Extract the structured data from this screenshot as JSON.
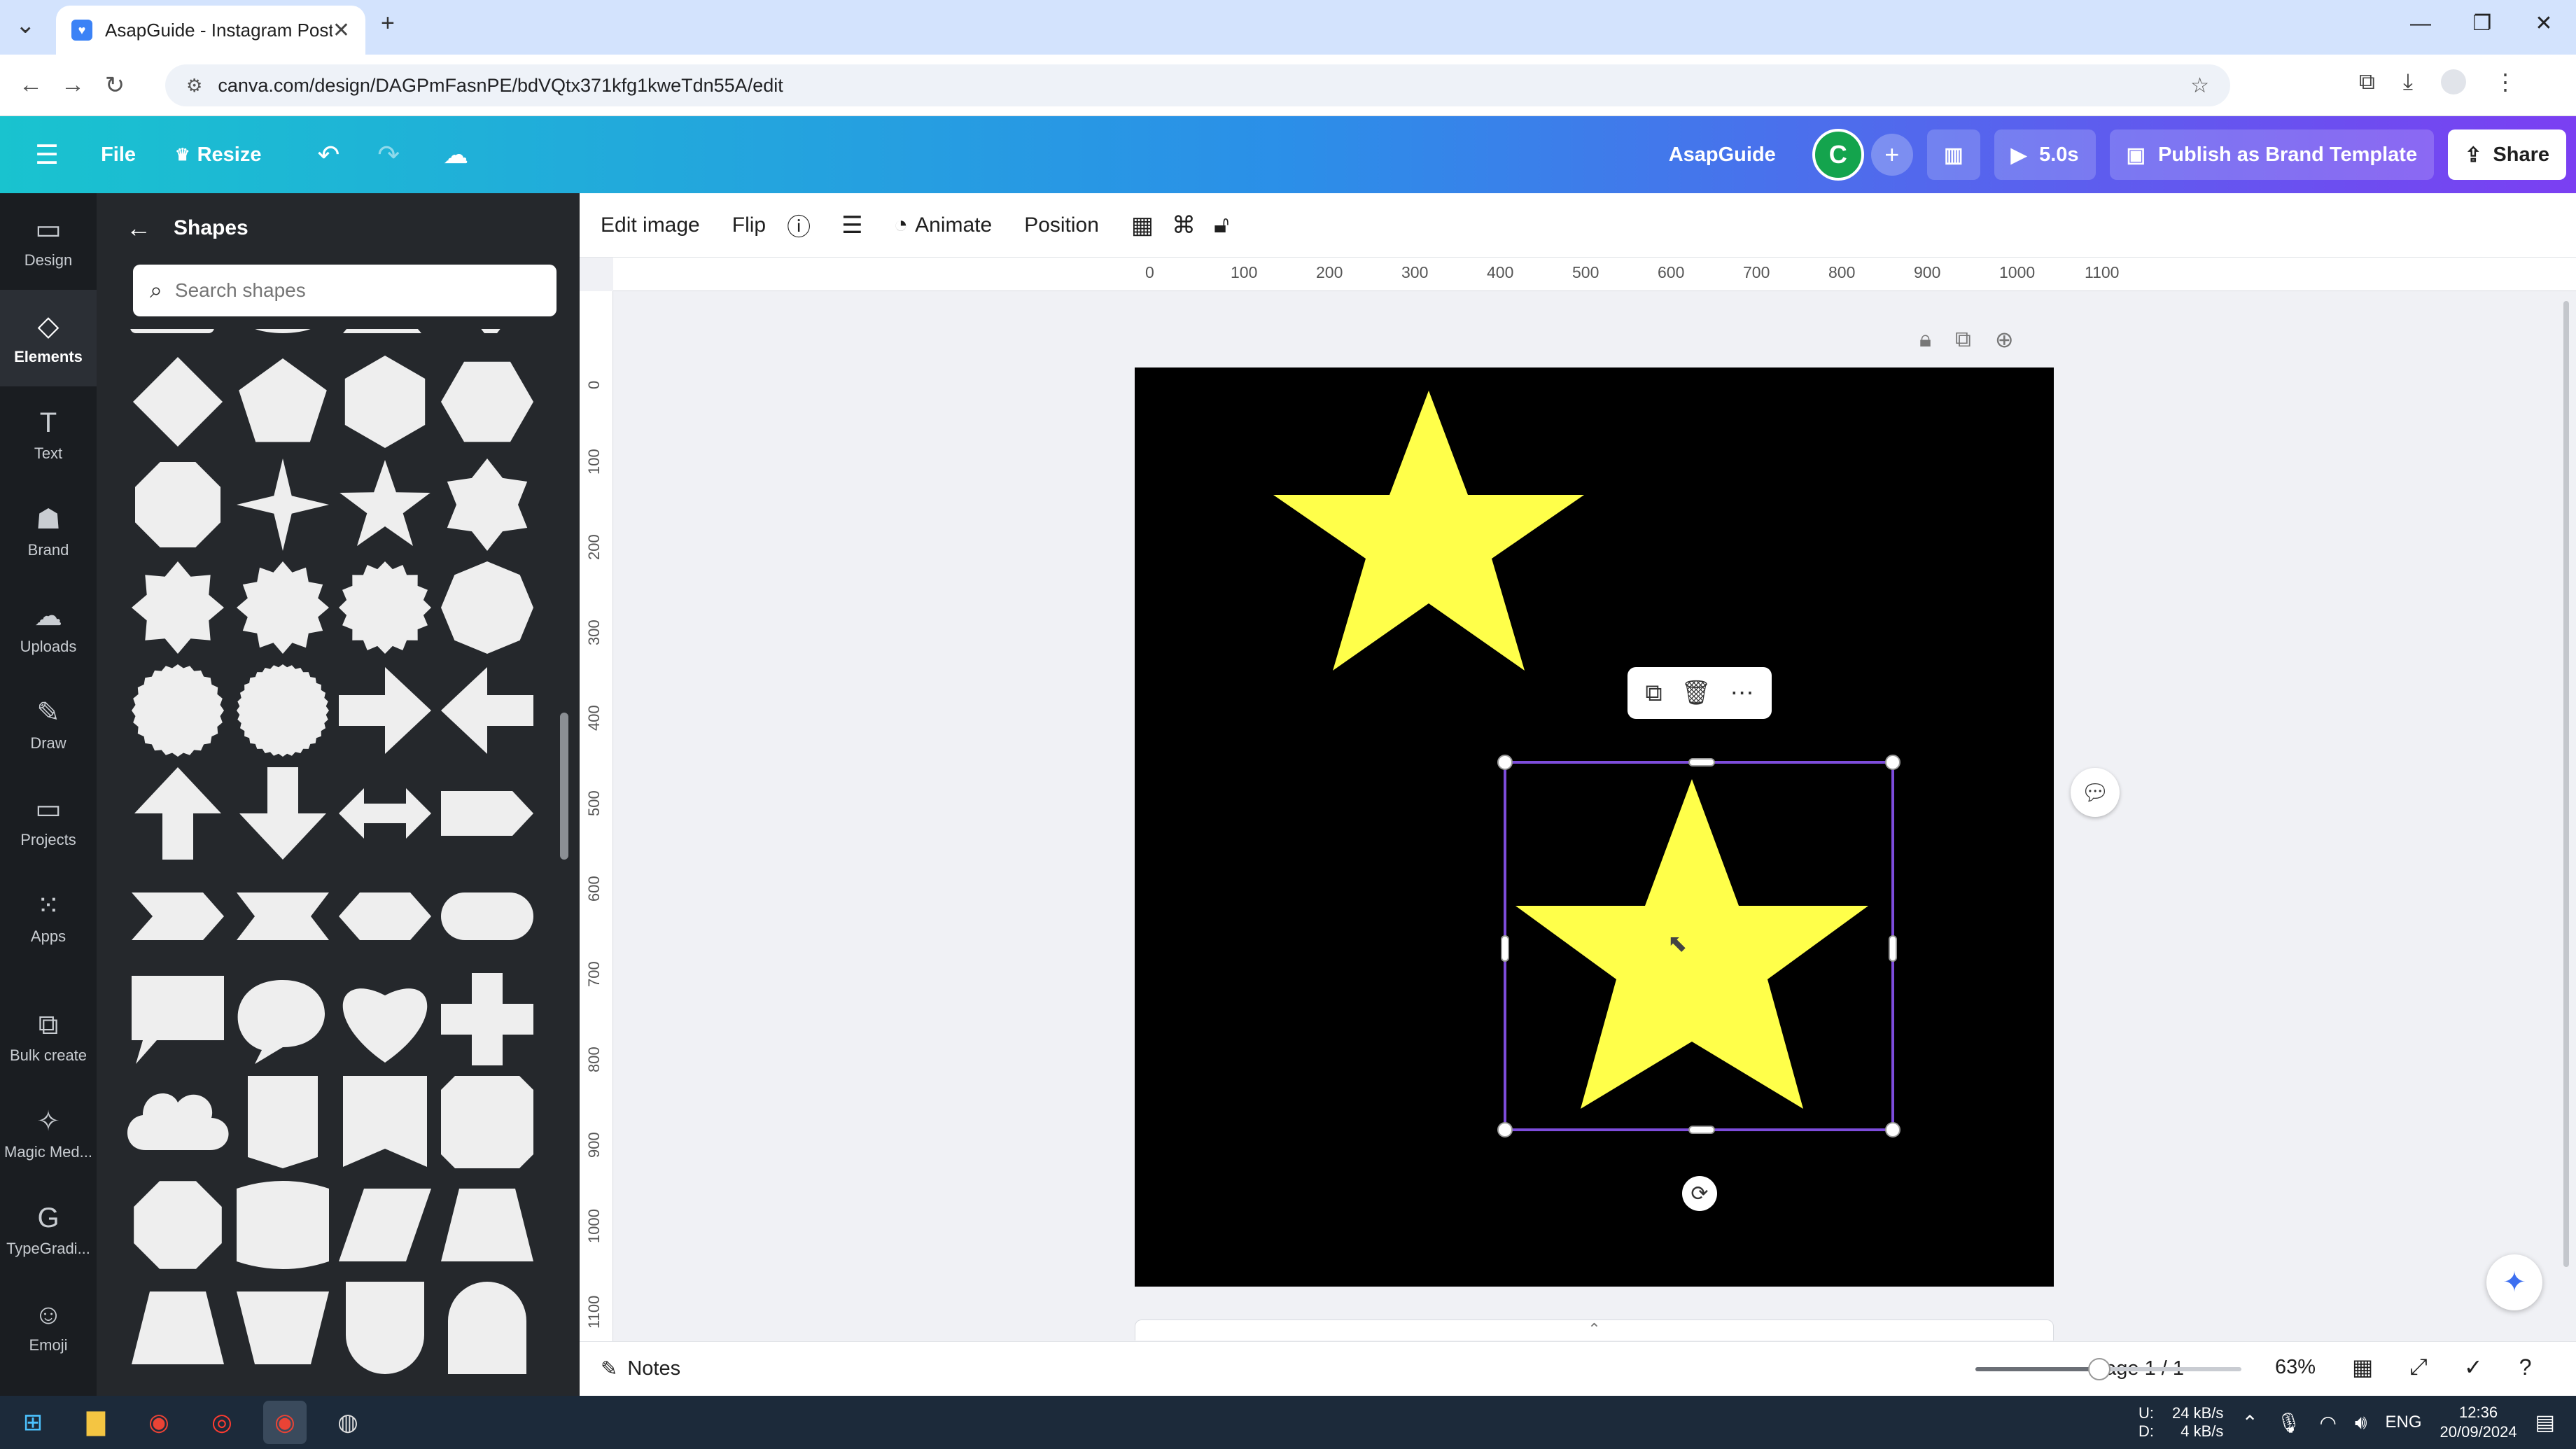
{
  "browser": {
    "tab_title": "AsapGuide - Instagram Post",
    "url": "canva.com/design/DAGPmFasnPE/bdVQtx371kfg1kweTdn55A/edit",
    "new_tab": "+",
    "close_tab": "✕"
  },
  "header": {
    "file_label": "File",
    "resize_label": "Resize",
    "team_name": "AsapGuide",
    "avatar_initial": "C",
    "duration_label": "5.0s",
    "publish_label": "Publish as Brand Template",
    "share_label": "Share",
    "colors": {
      "gradient_start": "#19c3cf",
      "gradient_mid": "#2b8fe8",
      "gradient_end": "#7b3ff2"
    }
  },
  "rail": {
    "items": [
      {
        "label": "Design",
        "icon": "design-icon"
      },
      {
        "label": "Elements",
        "icon": "elements-icon",
        "active": true
      },
      {
        "label": "Text",
        "icon": "text-icon"
      },
      {
        "label": "Brand",
        "icon": "brand-icon"
      },
      {
        "label": "Uploads",
        "icon": "uploads-icon"
      },
      {
        "label": "Draw",
        "icon": "draw-icon"
      },
      {
        "label": "Projects",
        "icon": "projects-icon"
      },
      {
        "label": "Apps",
        "icon": "apps-icon"
      },
      {
        "label": "Bulk create",
        "icon": "bulk-create-icon"
      },
      {
        "label": "Magic Med...",
        "icon": "magic-media-icon"
      },
      {
        "label": "TypeGradi...",
        "icon": "typegradient-icon"
      },
      {
        "label": "Emoji",
        "icon": "emoji-icon"
      }
    ]
  },
  "panel": {
    "title": "Shapes",
    "search_placeholder": "Search shapes",
    "shapes": [
      "diamond",
      "pentagon",
      "hexagon-flat",
      "hexagon",
      "octagon",
      "star-4",
      "star-5",
      "star-6",
      "burst-8",
      "burst-12",
      "burst-16",
      "octagon-rotated",
      "scallop-circle",
      "scallop-circle-fine",
      "arrow-right",
      "arrow-left",
      "arrow-up",
      "arrow-down",
      "arrow-double",
      "pentagon-arrow",
      "chevron",
      "ribbon-band",
      "hexagon-long",
      "pill",
      "speech-square",
      "speech-round",
      "heart",
      "cross",
      "cloud",
      "tag-down",
      "banner",
      "rounded-octagon-tall",
      "octagon-soft",
      "wave-rect",
      "parallelogram",
      "trapezoid",
      "trapezoid-wide",
      "trapezoid-inverted",
      "shield",
      "arch"
    ]
  },
  "context_toolbar": {
    "edit_image": "Edit image",
    "flip": "Flip",
    "animate": "Animate",
    "position": "Position"
  },
  "ruler": {
    "top_ticks": [
      "0",
      "100",
      "200",
      "300",
      "400",
      "500",
      "600",
      "700",
      "800",
      "900",
      "1000",
      "1100"
    ],
    "left_ticks": [
      "0",
      "100",
      "200",
      "300",
      "400",
      "500",
      "600",
      "700",
      "800",
      "900",
      "1000",
      "1100"
    ]
  },
  "canvas": {
    "background": "#000000",
    "star_color": "#ffff4a",
    "selection_color": "#7d4cdb"
  },
  "footer": {
    "notes_label": "Notes",
    "page_label": "Page 1 / 1",
    "zoom_label": "63%",
    "zoom_percent": 63
  },
  "taskbar": {
    "net_up_label": "U:",
    "net_down_label": "D:",
    "net_up": "24 kB/s",
    "net_down": "4 kB/s",
    "language": "ENG",
    "time": "12:36",
    "date": "20/09/2024"
  }
}
